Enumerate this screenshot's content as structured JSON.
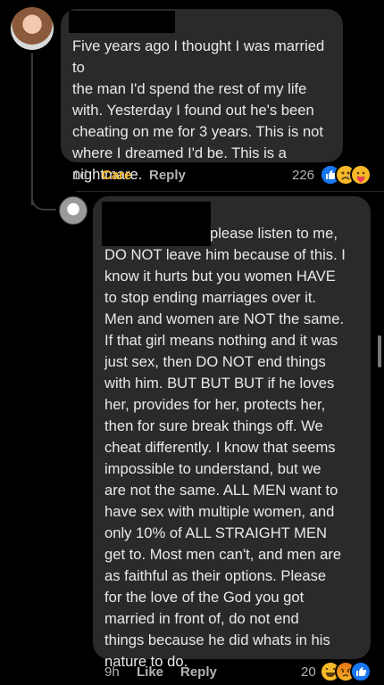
{
  "comment1": {
    "text": "Five years ago I thought I was married to\nthe man I'd spend the rest of my life\nwith. Yesterday I found out he's been\ncheating on me for 3 years. This is not\nwhere I dreamed I'd be. This is a\nnightmare.",
    "time": "1d",
    "care_label": "Care",
    "reply_label": "Reply",
    "reaction_count": "226"
  },
  "comment2": {
    "text": "please listen to me,\nDO NOT leave him because of this. I\nknow it hurts but you women HAVE\nto stop ending marriages over it.\nMen and women are NOT the same.\nIf that girl means nothing and it was\njust sex, then DO NOT end things\nwith him. BUT BUT BUT if he loves\nher, provides for her, protects her,\nthen for sure break things off. We\ncheat differently. I know that seems\nimpossible to understand, but we\nare not the same. ALL MEN want to\nhave sex with multiple women, and\nonly 10% of ALL STRAIGHT MEN\nget to. Most men can't, and men are\nas faithful as their options. Please\nfor the love of the God you got\nmarried in front of, do not end\nthings because he did whats in his\nnature to do.",
    "time": "9h",
    "like_label": "Like",
    "reply_label": "Reply",
    "reaction_count": "20"
  },
  "icons": {
    "comment1_reactions": [
      "like-icon",
      "sad-icon",
      "care-icon"
    ],
    "comment2_reactions": [
      "haha-icon",
      "angry-icon",
      "like-icon"
    ]
  },
  "colors": {
    "background": "#000000",
    "bubble": "#2a2a2c",
    "care": "#f7b928",
    "like_reaction": "#1877f2"
  }
}
